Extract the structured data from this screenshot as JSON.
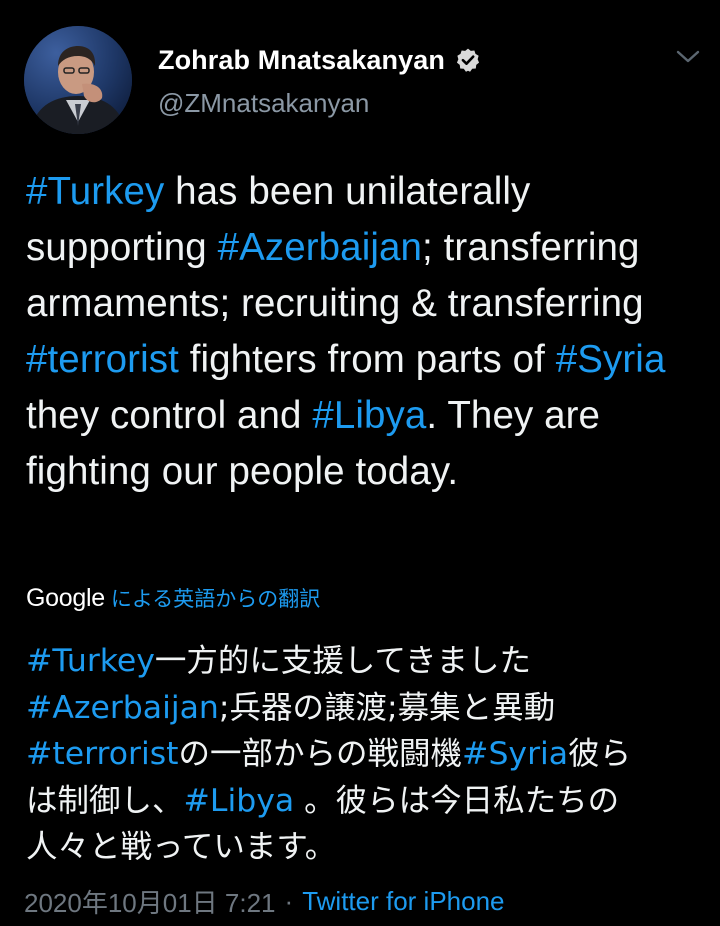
{
  "author": {
    "name": "Zohrab Mnatsakanyan",
    "handle": "@ZMnatsakanyan",
    "verified": true
  },
  "tweet": {
    "segments": [
      {
        "text": "#Turkey",
        "hashtag": true
      },
      {
        "text": " has been unilaterally supporting ",
        "hashtag": false
      },
      {
        "text": "#Azerbaijan",
        "hashtag": true
      },
      {
        "text": "; transferring armaments; recruiting & transferring ",
        "hashtag": false
      },
      {
        "text": "#terrorist",
        "hashtag": true
      },
      {
        "text": " fighters from parts of ",
        "hashtag": false
      },
      {
        "text": "#Syria",
        "hashtag": true
      },
      {
        "text": " they control and ",
        "hashtag": false
      },
      {
        "text": "#Libya",
        "hashtag": true
      },
      {
        "text": ". They are fighting our people today.",
        "hashtag": false
      }
    ]
  },
  "translation_header": {
    "provider": "Google",
    "label": "による英語からの翻訳"
  },
  "translation": {
    "lines": [
      [
        {
          "text": "#Turkey",
          "hashtag": true
        },
        {
          "text": "一方的に支援してきました",
          "hashtag": false
        }
      ],
      [
        {
          "text": "#Azerbaijan",
          "hashtag": true
        },
        {
          "text": ";兵器の譲渡;募集と異動",
          "hashtag": false
        }
      ],
      [
        {
          "text": "#terrorist",
          "hashtag": true
        },
        {
          "text": "の一部からの戦闘機",
          "hashtag": false
        },
        {
          "text": "#Syria",
          "hashtag": true
        },
        {
          "text": "彼ら",
          "hashtag": false
        }
      ],
      [
        {
          "text": "は制御し、",
          "hashtag": false
        },
        {
          "text": "#Libya",
          "hashtag": true
        },
        {
          "text": " 。彼らは今日私たちの",
          "hashtag": false
        }
      ],
      [
        {
          "text": "人々と戦っています。",
          "hashtag": false
        }
      ]
    ]
  },
  "meta": {
    "timestamp": "2020年10月01日 7:21",
    "separator": "·",
    "source": "Twitter for iPhone"
  },
  "colors": {
    "background": "#000000",
    "text": "#f0f3f4",
    "secondary": "#8b98a5",
    "accent": "#1d9bf0"
  },
  "icons": {
    "verified": "verified-badge-icon",
    "menu": "chevron-down-icon"
  }
}
